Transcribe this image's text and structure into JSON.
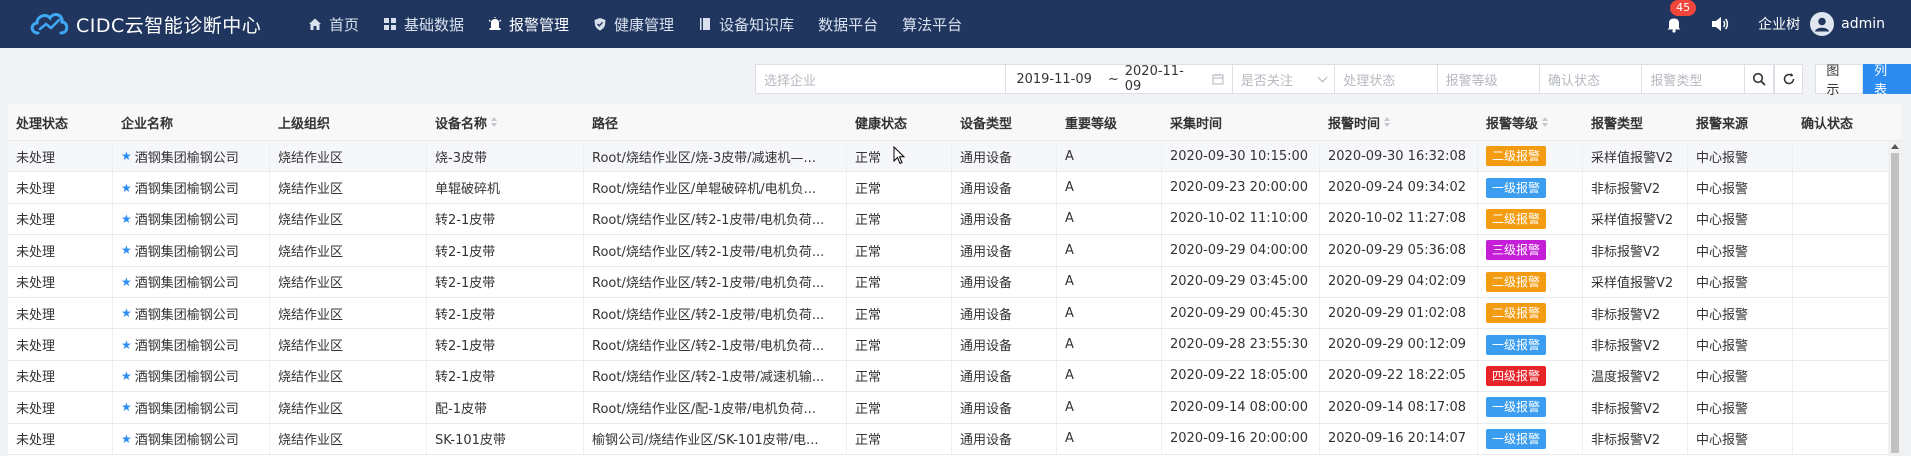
{
  "app": {
    "title": "CIDC云智能诊断中心"
  },
  "nav": [
    {
      "label": "首页",
      "icon": "home-icon"
    },
    {
      "label": "基础数据",
      "icon": "grid-icon"
    },
    {
      "label": "报警管理",
      "icon": "alarm-icon"
    },
    {
      "label": "健康管理",
      "icon": "shield-icon"
    },
    {
      "label": "设备知识库",
      "icon": "book-icon"
    },
    {
      "label": "数据平台",
      "icon": ""
    },
    {
      "label": "算法平台",
      "icon": ""
    }
  ],
  "header_right": {
    "badge_count": "45",
    "company": "企业树",
    "user": "admin"
  },
  "filters": {
    "company_placeholder": "选择企业",
    "date_start": "2019-11-09",
    "date_sep": "~",
    "date_end": "2020-11-09",
    "follow_placeholder": "是否关注",
    "process_placeholder": "处理状态",
    "level_placeholder": "报警等级",
    "confirm_placeholder": "确认状态",
    "type_placeholder": "报警类型",
    "view_chart": "图示",
    "view_list": "列表"
  },
  "colors": {
    "navbar": "#20365f",
    "accent": "#2d8cf0",
    "level1": "#3a9df0",
    "level2": "#f39c12",
    "level3": "#c41fd6",
    "level4": "#e8242b"
  },
  "table": {
    "headers": [
      "处理状态",
      "企业名称",
      "上级组织",
      "设备名称",
      "路径",
      "健康状态",
      "设备类型",
      "重要等级",
      "采集时间",
      "报警时间",
      "报警等级",
      "报警类型",
      "报警来源",
      "确认状态"
    ],
    "rows": [
      [
        "未处理",
        "酒钢集团榆钢公司",
        "烧结作业区",
        "烧-3皮带",
        "Root/烧结作业区/烧-3皮带/减速机—...",
        "正常",
        "通用设备",
        "A",
        "2020-09-30 10:15:00",
        "2020-09-30 16:32:08",
        "二级报警",
        "采样值报警V2",
        "中心报警",
        ""
      ],
      [
        "未处理",
        "酒钢集团榆钢公司",
        "烧结作业区",
        "单辊破碎机",
        "Root/烧结作业区/单辊破碎机/电机负...",
        "正常",
        "通用设备",
        "A",
        "2020-09-23 20:00:00",
        "2020-09-24 09:34:02",
        "一级报警",
        "非标报警V2",
        "中心报警",
        ""
      ],
      [
        "未处理",
        "酒钢集团榆钢公司",
        "烧结作业区",
        "转2-1皮带",
        "Root/烧结作业区/转2-1皮带/电机负荷...",
        "正常",
        "通用设备",
        "A",
        "2020-10-02 11:10:00",
        "2020-10-02 11:27:08",
        "二级报警",
        "采样值报警V2",
        "中心报警",
        ""
      ],
      [
        "未处理",
        "酒钢集团榆钢公司",
        "烧结作业区",
        "转2-1皮带",
        "Root/烧结作业区/转2-1皮带/电机负荷...",
        "正常",
        "通用设备",
        "A",
        "2020-09-29 04:00:00",
        "2020-09-29 05:36:08",
        "三级报警",
        "非标报警V2",
        "中心报警",
        ""
      ],
      [
        "未处理",
        "酒钢集团榆钢公司",
        "烧结作业区",
        "转2-1皮带",
        "Root/烧结作业区/转2-1皮带/电机负荷...",
        "正常",
        "通用设备",
        "A",
        "2020-09-29 03:45:00",
        "2020-09-29 04:02:09",
        "二级报警",
        "采样值报警V2",
        "中心报警",
        ""
      ],
      [
        "未处理",
        "酒钢集团榆钢公司",
        "烧结作业区",
        "转2-1皮带",
        "Root/烧结作业区/转2-1皮带/电机负荷...",
        "正常",
        "通用设备",
        "A",
        "2020-09-29 00:45:30",
        "2020-09-29 01:02:08",
        "二级报警",
        "非标报警V2",
        "中心报警",
        ""
      ],
      [
        "未处理",
        "酒钢集团榆钢公司",
        "烧结作业区",
        "转2-1皮带",
        "Root/烧结作业区/转2-1皮带/电机负荷...",
        "正常",
        "通用设备",
        "A",
        "2020-09-28 23:55:30",
        "2020-09-29 00:12:09",
        "一级报警",
        "非标报警V2",
        "中心报警",
        ""
      ],
      [
        "未处理",
        "酒钢集团榆钢公司",
        "烧结作业区",
        "转2-1皮带",
        "Root/烧结作业区/转2-1皮带/减速机输...",
        "正常",
        "通用设备",
        "A",
        "2020-09-22 18:05:00",
        "2020-09-22 18:22:05",
        "四级报警",
        "温度报警V2",
        "中心报警",
        ""
      ],
      [
        "未处理",
        "酒钢集团榆钢公司",
        "烧结作业区",
        "配-1皮带",
        "Root/烧结作业区/配-1皮带/电机负荷...",
        "正常",
        "通用设备",
        "A",
        "2020-09-14 08:00:00",
        "2020-09-14 08:17:08",
        "一级报警",
        "非标报警V2",
        "中心报警",
        ""
      ],
      [
        "未处理",
        "酒钢集团榆钢公司",
        "烧结作业区",
        "SK-101皮带",
        "榆钢公司/烧结作业区/SK-101皮带/电...",
        "正常",
        "通用设备",
        "A",
        "2020-09-16 20:00:00",
        "2020-09-16 20:14:07",
        "一级报警",
        "非标报警V2",
        "中心报警",
        ""
      ]
    ],
    "sortable_columns": [
      3,
      9,
      10
    ]
  }
}
